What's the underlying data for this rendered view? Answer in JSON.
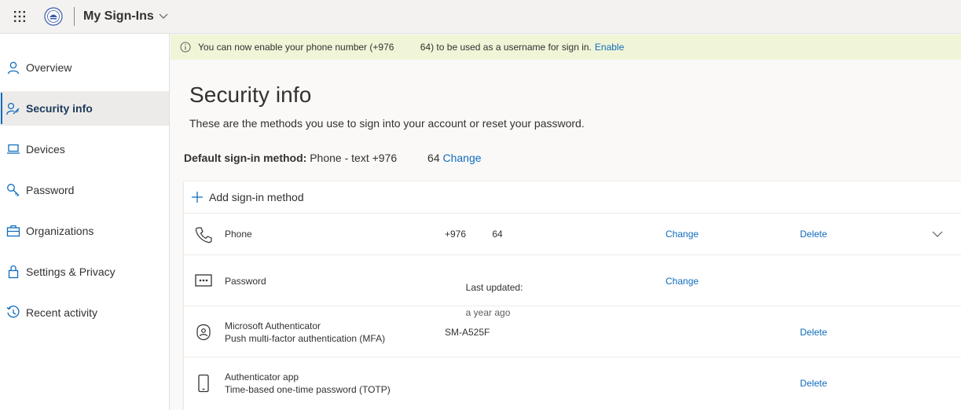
{
  "header": {
    "app_title": "My Sign-Ins",
    "icons": [
      "waffle-icon",
      "org-logo",
      "chevron-down-icon"
    ]
  },
  "sidebar": {
    "items": [
      {
        "label": "Overview",
        "icon": "person-icon",
        "active": false
      },
      {
        "label": "Security info",
        "icon": "person-key-icon",
        "active": true
      },
      {
        "label": "Devices",
        "icon": "laptop-icon",
        "active": false
      },
      {
        "label": "Password",
        "icon": "key-icon",
        "active": false
      },
      {
        "label": "Organizations",
        "icon": "briefcase-icon",
        "active": false
      },
      {
        "label": "Settings & Privacy",
        "icon": "lock-icon",
        "active": false
      },
      {
        "label": "Recent activity",
        "icon": "history-icon",
        "active": false
      }
    ]
  },
  "banner": {
    "text": "You can now enable your phone number (+976          64) to be used as a username for sign in.",
    "link": "Enable",
    "background": "#f1f5d8"
  },
  "main": {
    "title": "Security info",
    "description": "These are the methods you use to sign into your account or reset your password.",
    "default_label": "Default sign-in method:",
    "default_value": " Phone - text +976          64 ",
    "default_change": "Change",
    "add_method": "Add sign-in method",
    "methods": [
      {
        "name": "Phone",
        "name_sub": "",
        "detail": "+976          64",
        "detail_sub": "",
        "change": "Change",
        "delete": "Delete",
        "icon": "phone-icon"
      },
      {
        "name": "Password",
        "name_sub": "",
        "detail": "Last updated:",
        "detail_sub": "a year ago",
        "change": "Change",
        "delete": "",
        "icon": "password-icon"
      },
      {
        "name": "Microsoft Authenticator",
        "name_sub": "Push multi-factor authentication (MFA)",
        "detail": "SM-A525F",
        "detail_sub": "",
        "change": "",
        "delete": "Delete",
        "icon": "authenticator-icon"
      },
      {
        "name": "Authenticator app",
        "name_sub": "Time-based one-time password (TOTP)",
        "detail": "",
        "detail_sub": "",
        "change": "",
        "delete": "Delete",
        "icon": "mobile-icon"
      }
    ]
  },
  "colors": {
    "accent": "#0f6cbd",
    "active_nav_bg": "#edebe9"
  }
}
